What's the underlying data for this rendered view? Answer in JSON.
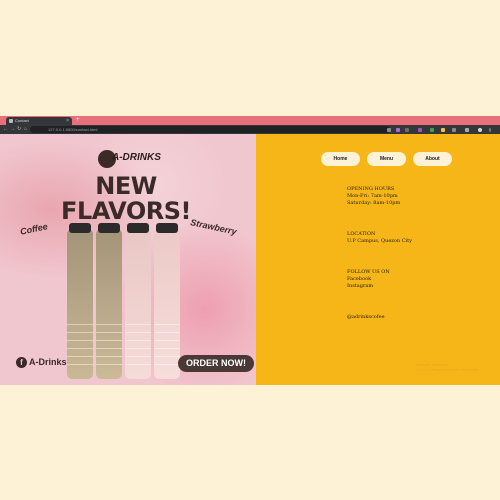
{
  "browser": {
    "tab_title": "Contact",
    "new_tab": "+",
    "tab_close": "×",
    "url": "127.0.0.1:5500/contact.html",
    "nav": {
      "back": "←",
      "forward": "→",
      "reload": "↻",
      "home": "⌂"
    }
  },
  "promo": {
    "brand": "A-DRINKS",
    "headline_line1": "NEW",
    "headline_line2": "FLAVORS!",
    "flavor_left": "Coffee",
    "flavor_right": "Strawberry",
    "social_handle": "A-Drinks",
    "social_icon": "f",
    "cta": "ORDER NOW!"
  },
  "nav": {
    "home": "Home",
    "menu": "Menu",
    "about": "About"
  },
  "info": {
    "hours_title": "OPENING HOURS",
    "hours_weekday": "Mon-Fri: 7am-10pm",
    "hours_saturday": "Saturday: 8am-10pm",
    "location_title": "LOCATION",
    "location_value": "U.P Campus, Quezon City",
    "follow_title": "FOLLOW US ON",
    "follow_facebook": "Facebook",
    "follow_instagram": "Instagram",
    "email": "@adrinkscofee"
  },
  "watermark": {
    "line1": "Activate Windows",
    "line2": "Go to Settings to activate Windows."
  },
  "colors": {
    "chrome_tab_strip": "#e8707b",
    "chrome_toolbar": "#35363a",
    "panel_yellow": "#f7b618",
    "nav_button_bg": "#fdf1d6",
    "page_background": "#fdf1d6",
    "brand_brown": "#3a2a28"
  },
  "icons": [
    "favicon-icon",
    "back-icon",
    "forward-icon",
    "reload-icon",
    "home-icon",
    "extension-icon",
    "profile-avatar-icon",
    "facebook-icon"
  ]
}
